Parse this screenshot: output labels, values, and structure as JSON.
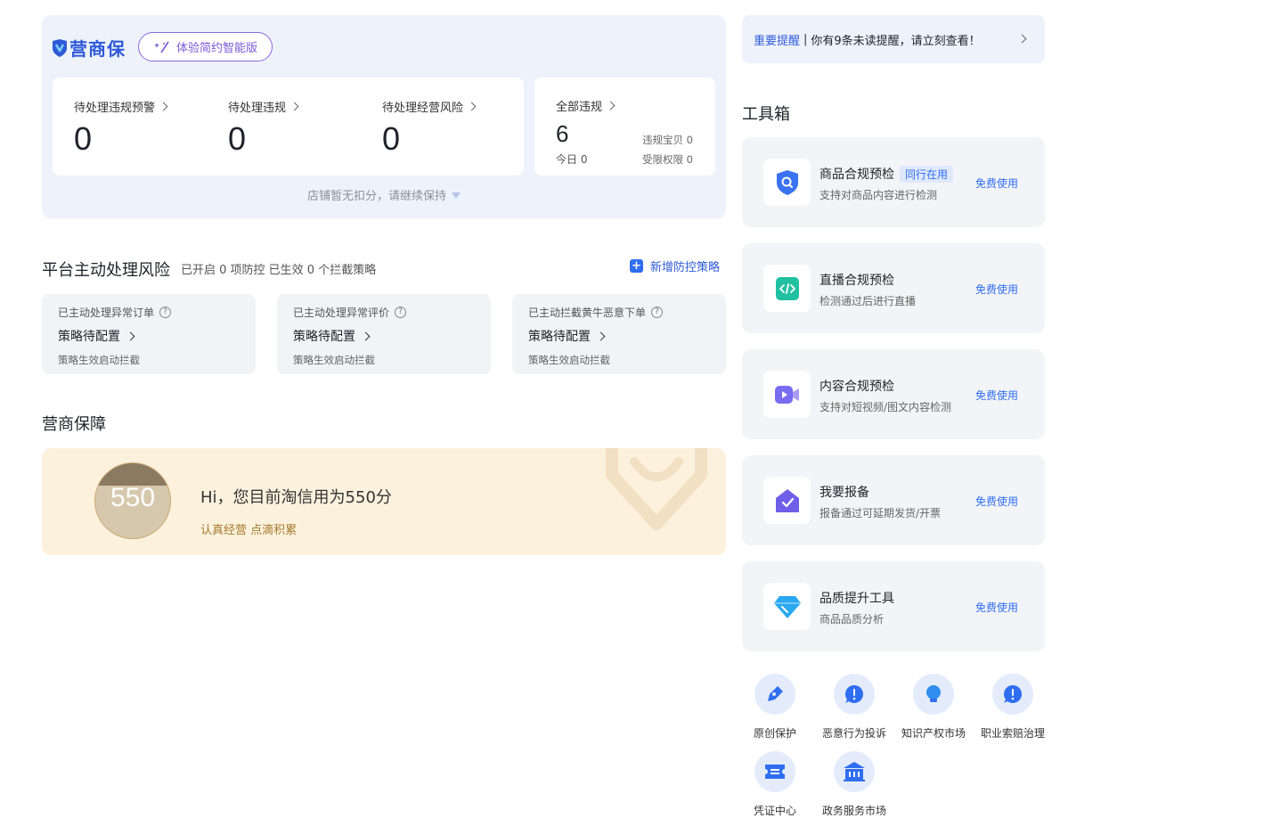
{
  "summary": {
    "brand": "营商保",
    "smart_button": "体验简约智能版",
    "stats": [
      {
        "label": "待处理违规预警",
        "value": "0"
      },
      {
        "label": "待处理违规",
        "value": "0"
      },
      {
        "label": "待处理经营风险",
        "value": "0"
      }
    ],
    "all": {
      "label": "全部违规",
      "value": "6",
      "today": "今日 0",
      "items_label": "违规宝贝 0",
      "limits_label": "受限权限 0"
    },
    "deduct_note": "店铺暂无扣分，请继续保持"
  },
  "risk": {
    "title": "平台主动处理风险",
    "subtitle": "已开启 0 项防控 已生效 0 个拦截策略",
    "add_label": "新增防控策略",
    "cards": [
      {
        "title": "已主动处理异常订单",
        "status": "策略待配置",
        "note": "策略生效启动拦截"
      },
      {
        "title": "已主动处理异常评价",
        "status": "策略待配置",
        "note": "策略生效启动拦截"
      },
      {
        "title": "已主动拦截黄牛恶意下单",
        "status": "策略待配置",
        "note": "策略生效启动拦截"
      }
    ]
  },
  "guarantee": {
    "title": "营商保障",
    "score": "550",
    "greeting": "Hi，您目前淘信用为550分",
    "motto": "认真经营 点滴积累"
  },
  "notice": {
    "tag": "重要提醒",
    "separator": "|",
    "text": "你有9条未读提醒，请立刻查看！"
  },
  "toolbox": {
    "title": "工具箱",
    "tools": [
      {
        "name": "商品合规预检",
        "tag": "同行在用",
        "desc": "支持对商品内容进行检测",
        "action": "免费使用",
        "icon": "shield-search-icon"
      },
      {
        "name": "直播合规预检",
        "tag": "",
        "desc": "检测通过后进行直播",
        "action": "免费使用",
        "icon": "code-icon"
      },
      {
        "name": "内容合规预检",
        "tag": "",
        "desc": "支持对短视频/图文内容检测",
        "action": "免费使用",
        "icon": "video-icon"
      },
      {
        "name": "我要报备",
        "tag": "",
        "desc": "报备通过可延期发货/开票",
        "action": "免费使用",
        "icon": "report-check-icon"
      },
      {
        "name": "品质提升工具",
        "tag": "",
        "desc": "商品品质分析",
        "action": "免费使用",
        "icon": "diamond-icon"
      }
    ],
    "quick_links": [
      {
        "label": "原创保护",
        "icon": "pen-icon"
      },
      {
        "label": "恶意行为投诉",
        "icon": "alert-icon"
      },
      {
        "label": "知识产权市场",
        "icon": "bulb-icon"
      },
      {
        "label": "职业索赔治理",
        "icon": "alert-icon"
      },
      {
        "label": "凭证中心",
        "icon": "ticket-icon"
      },
      {
        "label": "政务服务市场",
        "icon": "government-icon"
      }
    ]
  },
  "colors": {
    "accent": "#2f6ef0",
    "brand": "#2f5bd8",
    "summary_bg": "#eef2fb",
    "guarantee_bg": "#fcf1dd",
    "gold_text": "#a57b2b"
  }
}
